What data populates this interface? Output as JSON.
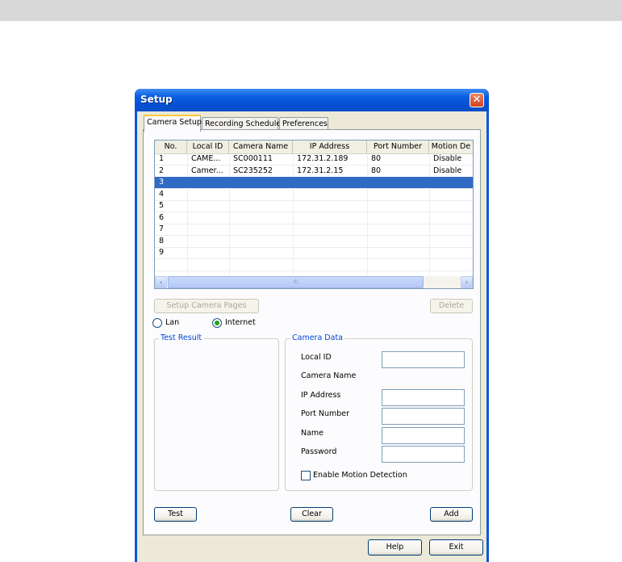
{
  "window": {
    "title": "Setup",
    "close_glyph": "✕"
  },
  "tabs": [
    {
      "label": "Camera Setup",
      "active": true
    },
    {
      "label": "Recording Schedule",
      "active": false
    },
    {
      "label": "Preferences",
      "active": false
    }
  ],
  "camera_list": {
    "columns": [
      "No.",
      "Local ID",
      "Camera Name",
      "IP Address",
      "Port Number",
      "Motion De"
    ],
    "rows": [
      {
        "no": "1",
        "local_id": "CAME...",
        "camera_name": "SC000111",
        "ip": "172.31.2.189",
        "port": "80",
        "motion": "Disable"
      },
      {
        "no": "2",
        "local_id": "Camer...",
        "camera_name": "SC235252",
        "ip": "172.31.2.15",
        "port": "80",
        "motion": "Disable"
      },
      {
        "no": "3",
        "local_id": "",
        "camera_name": "",
        "ip": "",
        "port": "",
        "motion": ""
      },
      {
        "no": "4",
        "local_id": "",
        "camera_name": "",
        "ip": "",
        "port": "",
        "motion": ""
      },
      {
        "no": "5",
        "local_id": "",
        "camera_name": "",
        "ip": "",
        "port": "",
        "motion": ""
      },
      {
        "no": "6",
        "local_id": "",
        "camera_name": "",
        "ip": "",
        "port": "",
        "motion": ""
      },
      {
        "no": "7",
        "local_id": "",
        "camera_name": "",
        "ip": "",
        "port": "",
        "motion": ""
      },
      {
        "no": "8",
        "local_id": "",
        "camera_name": "",
        "ip": "",
        "port": "",
        "motion": ""
      },
      {
        "no": "9",
        "local_id": "",
        "camera_name": "",
        "ip": "",
        "port": "",
        "motion": ""
      }
    ],
    "selected_row": 2,
    "scroll_left": "‹",
    "scroll_right": "›",
    "scroll_grip": "III"
  },
  "buttons": {
    "setup_camera_pages": "Setup Camera Pages",
    "delete": "Delete",
    "test": "Test",
    "clear": "Clear",
    "add": "Add",
    "help": "Help",
    "exit": "Exit"
  },
  "connection": {
    "lan_label": "Lan",
    "internet_label": "Internet",
    "selected": "Internet"
  },
  "test_result": {
    "title": "Test Result"
  },
  "camera_data": {
    "title": "Camera Data",
    "local_id_label": "Local ID",
    "camera_name_label": "Camera Name",
    "ip_address_label": "IP Address",
    "port_number_label": "Port Number",
    "name_label": "Name",
    "password_label": "Password",
    "local_id_value": "",
    "ip_address_value": "",
    "port_number_value": "",
    "name_value": "",
    "password_value": "",
    "enable_motion_label": "Enable Motion Detection",
    "enable_motion_checked": false
  }
}
